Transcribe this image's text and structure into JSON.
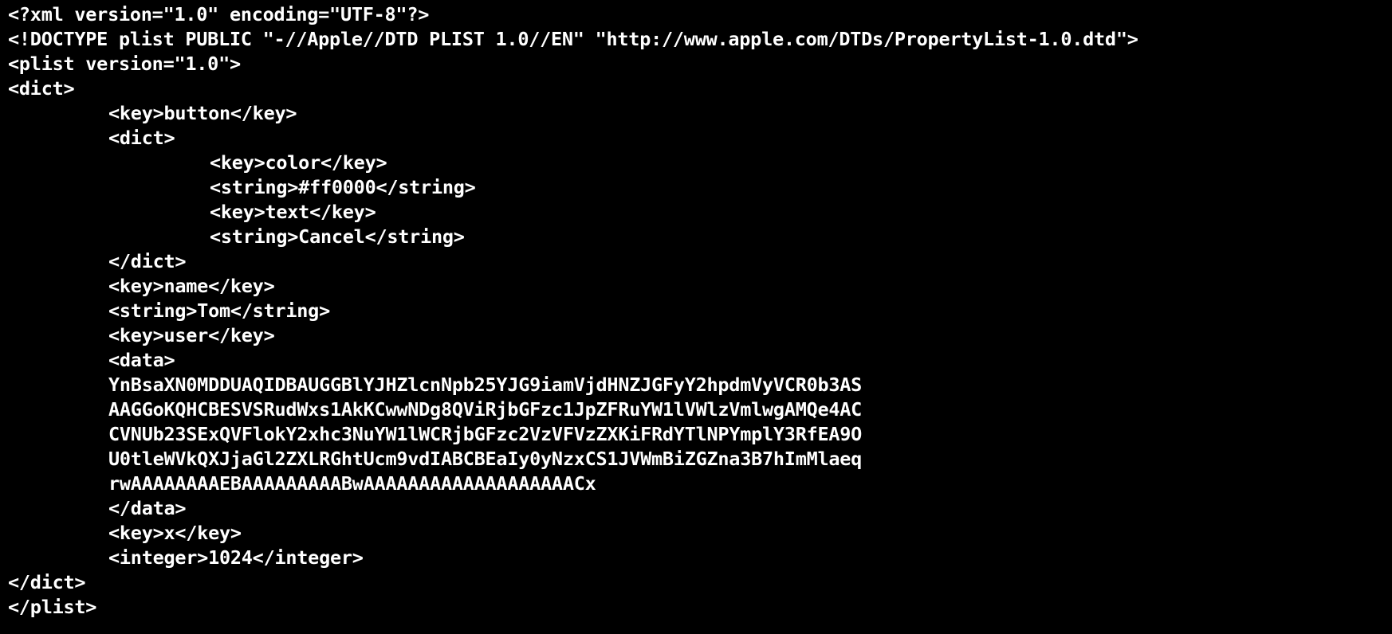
{
  "colors": {
    "background": "#000000",
    "text": "#ffffff"
  },
  "lines": [
    "<?xml version=\"1.0\" encoding=\"UTF-8\"?>",
    "<!DOCTYPE plist PUBLIC \"-//Apple//DTD PLIST 1.0//EN\" \"http://www.apple.com/DTDs/PropertyList-1.0.dtd\">",
    "<plist version=\"1.0\">",
    "<dict>",
    "<key>button</key>",
    "<dict>",
    "<key>color</key>",
    "<string>#ff0000</string>",
    "<key>text</key>",
    "<string>Cancel</string>",
    "</dict>",
    "<key>name</key>",
    "<string>Tom</string>",
    "<key>user</key>",
    "<data>",
    "YnBsaXN0MDDUAQIDBAUGGBlYJHZlcnNpb25YJG9iamVjdHNZJGFyY2hpdmVyVCR0b3AS",
    "AAGGoKQHCBESVSRudWxs1AkKCwwNDg8QViRjbGFzc1JpZFRuYW1lVWlzVmlwgAMQe4AC",
    "CVNUb23SExQVFlokY2xhc3NuYW1lWCRjbGFzc2VzVFVzZXKiFRdYTlNPYmplY3RfEA9O",
    "U0tleWVkQXJjaGl2ZXLRGhtUcm9vdIABCBEaIy0yNzxCS1JVWmBiZGZna3B7hImMlaeq",
    "rwAAAAAAAAEBAAAAAAAAABwAAAAAAAAAAAAAAAAAAACx",
    "</data>",
    "<key>x</key>",
    "<integer>1024</integer>",
    "</dict>",
    "</plist>"
  ]
}
